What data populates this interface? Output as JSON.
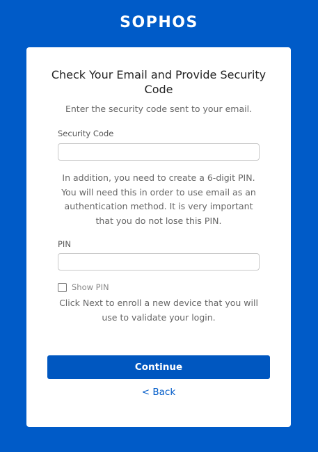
{
  "brand": {
    "logo_text": "SOPHOS",
    "colors": {
      "background": "#005bc8",
      "button": "#0057c0",
      "link": "#005bc8"
    }
  },
  "form": {
    "title": "Check Your Email and Provide Security Code",
    "subtitle": "Enter the security code sent to your email.",
    "security_code": {
      "label": "Security Code",
      "value": "",
      "placeholder": ""
    },
    "pin_instructions": "In addition, you need to create a 6-digit PIN. You will need this in order to use email as an authentication method. It is very important that you do not lose this PIN.",
    "pin": {
      "label": "PIN",
      "value": "",
      "placeholder": ""
    },
    "show_pin": {
      "label": "Show PIN",
      "checked": false
    },
    "next_instructions": "Click Next to enroll a new device that you will use to validate your login.",
    "continue_label": "Continue",
    "back_label": "< Back"
  }
}
